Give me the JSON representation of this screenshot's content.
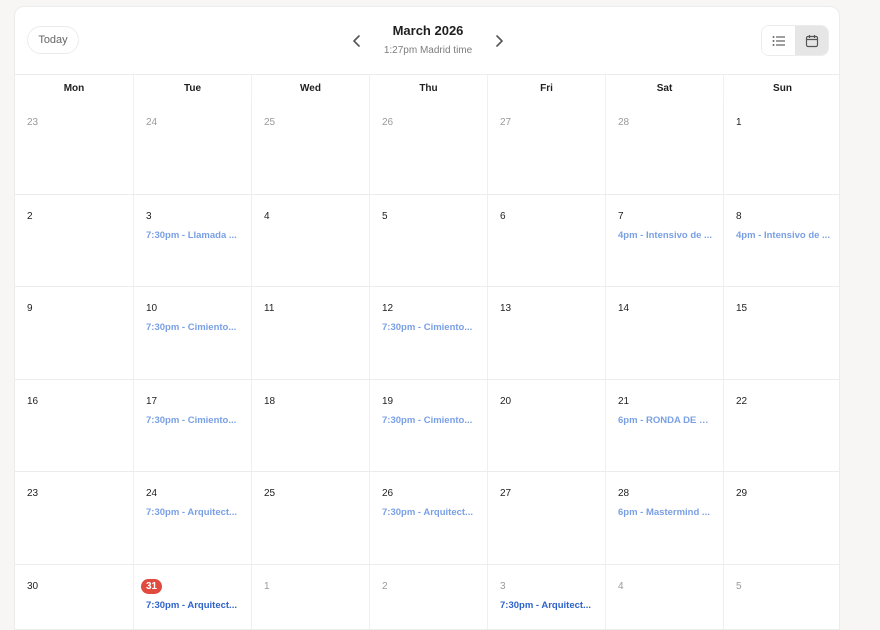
{
  "header": {
    "today_label": "Today",
    "month_title": "March 2026",
    "timezone_text": "1:27pm Madrid time"
  },
  "weekdays": [
    "Mon",
    "Tue",
    "Wed",
    "Thu",
    "Fri",
    "Sat",
    "Sun"
  ],
  "weeks": [
    [
      {
        "day": "23",
        "muted": true,
        "events": []
      },
      {
        "day": "24",
        "muted": true,
        "events": []
      },
      {
        "day": "25",
        "muted": true,
        "events": []
      },
      {
        "day": "26",
        "muted": true,
        "events": []
      },
      {
        "day": "27",
        "muted": true,
        "events": []
      },
      {
        "day": "28",
        "muted": true,
        "events": []
      },
      {
        "day": "1",
        "events": []
      }
    ],
    [
      {
        "day": "2",
        "events": []
      },
      {
        "day": "3",
        "events": [
          "7:30pm - Llamada ..."
        ]
      },
      {
        "day": "4",
        "events": []
      },
      {
        "day": "5",
        "events": []
      },
      {
        "day": "6",
        "events": []
      },
      {
        "day": "7",
        "events": [
          "4pm - Intensivo de ..."
        ]
      },
      {
        "day": "8",
        "events": [
          "4pm - Intensivo de ..."
        ]
      }
    ],
    [
      {
        "day": "9",
        "events": []
      },
      {
        "day": "10",
        "events": [
          "7:30pm - Cimiento..."
        ]
      },
      {
        "day": "11",
        "events": []
      },
      {
        "day": "12",
        "events": [
          "7:30pm - Cimiento..."
        ]
      },
      {
        "day": "13",
        "events": []
      },
      {
        "day": "14",
        "events": []
      },
      {
        "day": "15",
        "events": []
      }
    ],
    [
      {
        "day": "16",
        "events": []
      },
      {
        "day": "17",
        "events": [
          "7:30pm - Cimiento..."
        ]
      },
      {
        "day": "18",
        "events": []
      },
      {
        "day": "19",
        "events": [
          "7:30pm - Cimiento..."
        ]
      },
      {
        "day": "20",
        "events": []
      },
      {
        "day": "21",
        "events": [
          "6pm - RONDA DE Q..."
        ]
      },
      {
        "day": "22",
        "events": []
      }
    ],
    [
      {
        "day": "23",
        "events": []
      },
      {
        "day": "24",
        "events": [
          "7:30pm - Arquitect..."
        ]
      },
      {
        "day": "25",
        "events": []
      },
      {
        "day": "26",
        "events": [
          "7:30pm - Arquitect..."
        ]
      },
      {
        "day": "27",
        "events": []
      },
      {
        "day": "28",
        "events": [
          "6pm - Mastermind ..."
        ]
      },
      {
        "day": "29",
        "events": []
      }
    ],
    [
      {
        "day": "30",
        "events": []
      },
      {
        "day": "31",
        "today": true,
        "current": true,
        "events": [
          "7:30pm - Arquitect..."
        ]
      },
      {
        "day": "1",
        "muted": true,
        "events": []
      },
      {
        "day": "2",
        "muted": true,
        "events": []
      },
      {
        "day": "3",
        "muted": true,
        "current": true,
        "events": [
          "7:30pm - Arquitect..."
        ]
      },
      {
        "day": "4",
        "muted": true,
        "events": []
      },
      {
        "day": "5",
        "muted": true,
        "events": []
      }
    ]
  ],
  "icons": {
    "prev": "chevron-left-icon",
    "next": "chevron-right-icon",
    "list_view": "list-icon",
    "month_view": "calendar-icon"
  },
  "colors": {
    "today_badge": "#e04a3f",
    "event_past": "#7aa0e4",
    "event_upcoming": "#2e63c9"
  }
}
